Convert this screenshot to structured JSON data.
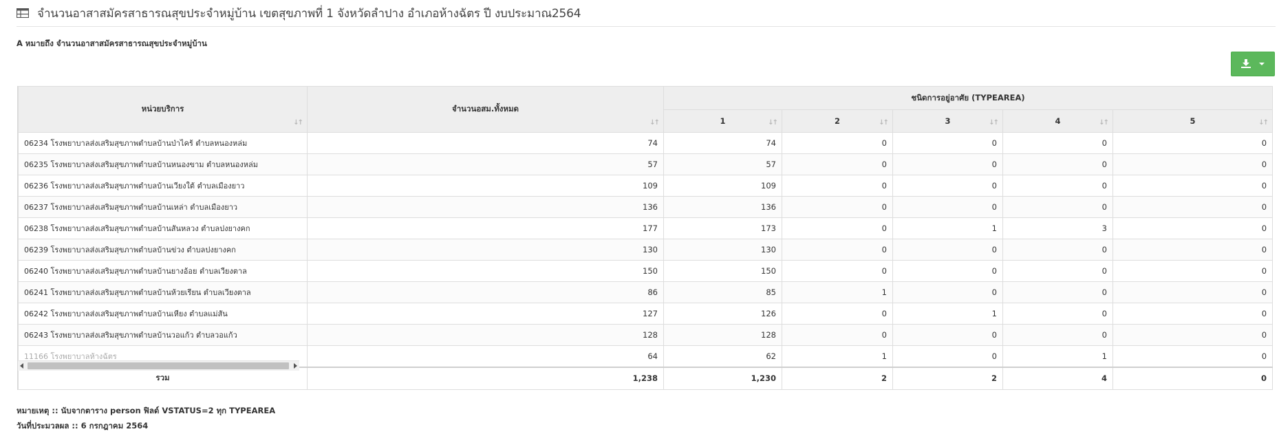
{
  "header": {
    "title": "จำนวนอาสาสมัครสาธารณสุขประจำหมู่บ้าน เขตสุขภาพที่ 1 จังหวัดลำปาง อำเภอห้างฉัตร ปี งบประมาณ2564",
    "icon": "table-icon"
  },
  "subtitle": "A หมายถึง จำนวนอาสาสมัครสาธารณสุขประจำหมู่บ้าน",
  "toolbar": {
    "export_icon": "download-icon",
    "accent": "#5cb85c"
  },
  "table": {
    "headers": {
      "unit": "หน่วยบริการ",
      "total": "จำนวนอสม.ทั้งหมด",
      "group": "ชนิดการอยู่อาศัย (TYPEAREA)",
      "t1": "1",
      "t2": "2",
      "t3": "3",
      "t4": "4",
      "t5": "5"
    },
    "rows": [
      {
        "unit": "06234 โรงพยาบาลส่งเสริมสุขภาพตำบลบ้านป่าไคร้ ตำบลหนองหล่ม",
        "total": "74",
        "t1": "74",
        "t2": "0",
        "t3": "0",
        "t4": "0",
        "t5": "0"
      },
      {
        "unit": "06235 โรงพยาบาลส่งเสริมสุขภาพตำบลบ้านหนองขาม ตำบลหนองหล่ม",
        "total": "57",
        "t1": "57",
        "t2": "0",
        "t3": "0",
        "t4": "0",
        "t5": "0"
      },
      {
        "unit": "06236 โรงพยาบาลส่งเสริมสุขภาพตำบลบ้านเวียงใต้ ตำบลเมืองยาว",
        "total": "109",
        "t1": "109",
        "t2": "0",
        "t3": "0",
        "t4": "0",
        "t5": "0"
      },
      {
        "unit": "06237 โรงพยาบาลส่งเสริมสุขภาพตำบลบ้านเหล่า ตำบลเมืองยาว",
        "total": "136",
        "t1": "136",
        "t2": "0",
        "t3": "0",
        "t4": "0",
        "t5": "0"
      },
      {
        "unit": "06238 โรงพยาบาลส่งเสริมสุขภาพตำบลบ้านสันหลวง ตำบลปงยางคก",
        "total": "177",
        "t1": "173",
        "t2": "0",
        "t3": "1",
        "t4": "3",
        "t5": "0"
      },
      {
        "unit": "06239 โรงพยาบาลส่งเสริมสุขภาพตำบลบ้านข่วง ตำบลปงยางคก",
        "total": "130",
        "t1": "130",
        "t2": "0",
        "t3": "0",
        "t4": "0",
        "t5": "0"
      },
      {
        "unit": "06240 โรงพยาบาลส่งเสริมสุขภาพตำบลบ้านยางอ้อย ตำบลเวียงตาล",
        "total": "150",
        "t1": "150",
        "t2": "0",
        "t3": "0",
        "t4": "0",
        "t5": "0"
      },
      {
        "unit": "06241 โรงพยาบาลส่งเสริมสุขภาพตำบลบ้านห้วยเรียน ตำบลเวียงตาล",
        "total": "86",
        "t1": "85",
        "t2": "1",
        "t3": "0",
        "t4": "0",
        "t5": "0"
      },
      {
        "unit": "06242 โรงพยาบาลส่งเสริมสุขภาพตำบลบ้านเหียง ตำบลแม่สัน",
        "total": "127",
        "t1": "126",
        "t2": "0",
        "t3": "1",
        "t4": "0",
        "t5": "0"
      },
      {
        "unit": "06243 โรงพยาบาลส่งเสริมสุขภาพตำบลบ้านวอแก้ว ตำบลวอแก้ว",
        "total": "128",
        "t1": "128",
        "t2": "0",
        "t3": "0",
        "t4": "0",
        "t5": "0"
      },
      {
        "unit": "11166 โรงพยาบาลห้างฉัตร",
        "total": "64",
        "t1": "62",
        "t2": "1",
        "t3": "0",
        "t4": "1",
        "t5": "0"
      }
    ],
    "footer": {
      "label": "รวม",
      "total": "1,238",
      "t1": "1,230",
      "t2": "2",
      "t3": "2",
      "t4": "4",
      "t5": "0"
    }
  },
  "notes": {
    "remark": "หมายเหตุ :: นับจากตาราง person ฟิลด์ VSTATUS=2 ทุก TYPEAREA",
    "processed": "วันที่ประมวลผล :: 6 กรกฎาคม 2564"
  }
}
